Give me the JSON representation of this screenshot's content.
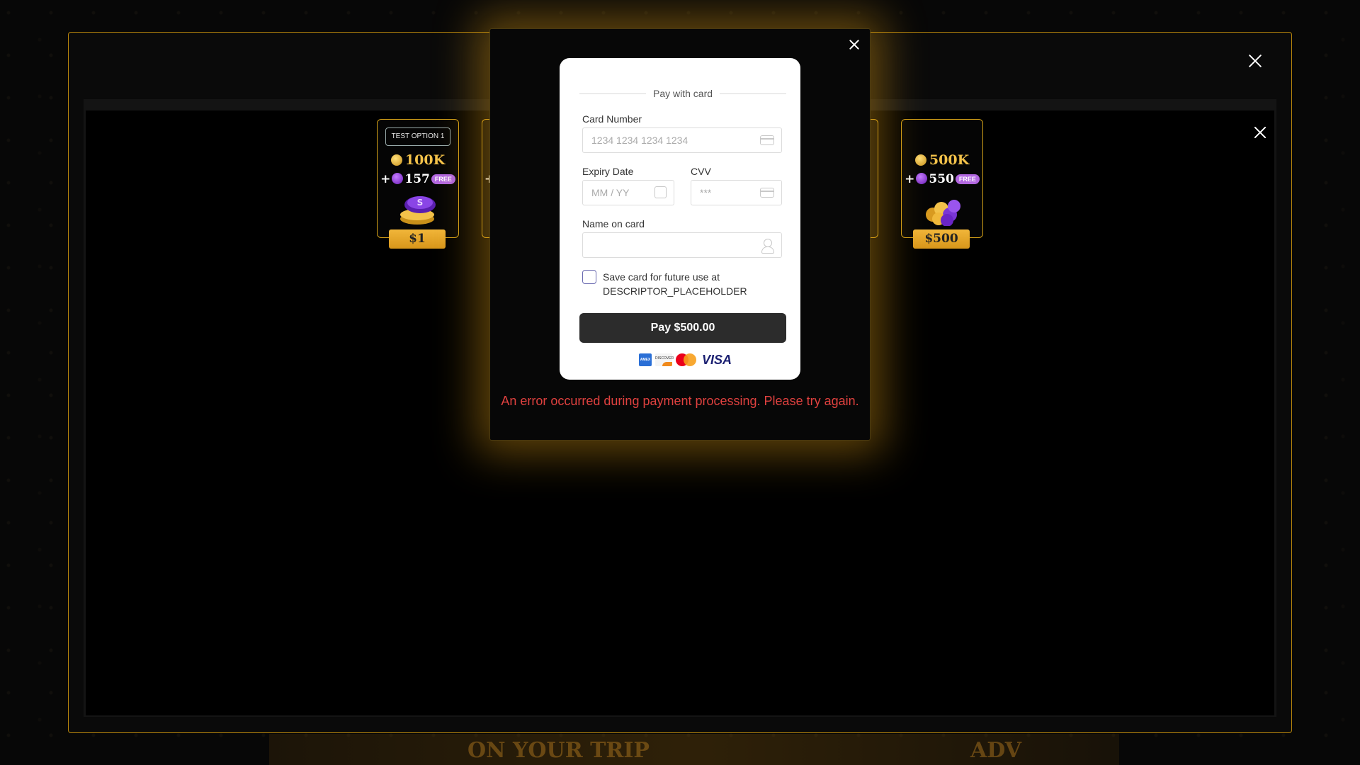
{
  "store": {
    "packages": [
      {
        "tag": "TEST OPTION 1",
        "coins": "100K",
        "bonus_prefix": "+",
        "bonus": "157",
        "free_label": "FREE",
        "price": "$1",
        "stack_icon": "purple-gold-coin-stack"
      },
      {
        "tag": "",
        "coins": "500K",
        "bonus_prefix": "+",
        "bonus": "550",
        "free_label": "FREE",
        "price": "$500",
        "stack_icon": "gold-purple-coin-pile"
      }
    ],
    "background_banner_text": [
      "ON YOUR TRIP",
      "ADV"
    ]
  },
  "payment": {
    "heading": "Pay with card",
    "card_number": {
      "label": "Card Number",
      "placeholder": "1234 1234 1234 1234",
      "value": ""
    },
    "expiry": {
      "label": "Expiry Date",
      "placeholder": "MM / YY",
      "value": ""
    },
    "cvv": {
      "label": "CVV",
      "placeholder": "***",
      "value": ""
    },
    "name": {
      "label": "Name on card",
      "placeholder": "",
      "value": ""
    },
    "save_card_text": "Save card for future use at DESCRIPTOR_PLACEHOLDER",
    "save_card_checked": false,
    "pay_button": "Pay $500.00",
    "brand_icons": [
      "amex-icon",
      "discover-icon",
      "mastercard-icon",
      "visa-icon"
    ],
    "brand_labels": {
      "amex": "AMEX",
      "discover": "DISCOVER",
      "visa": "VISA"
    },
    "error_message": "An error occurred during payment processing. Please try again."
  },
  "colors": {
    "accent_gold": "#d4a017",
    "error_red": "#e0413f",
    "pay_button": "#2c2c2c"
  }
}
